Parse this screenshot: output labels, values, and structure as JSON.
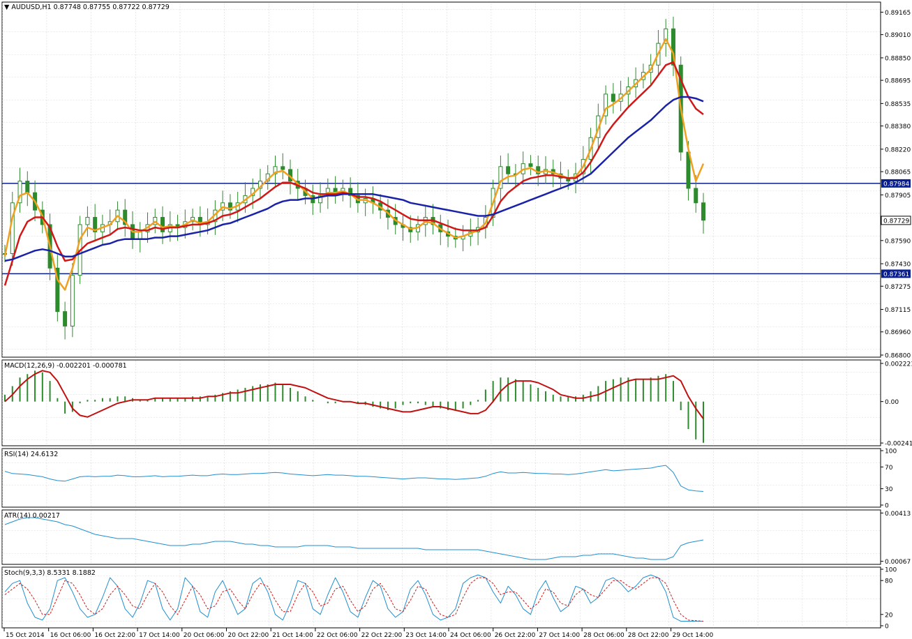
{
  "chart_data": [
    {
      "type": "line",
      "panel": "price",
      "title": "AUDUSD,H1 0.87748 0.87755 0.87722 0.87729",
      "ylim": [
        0.868,
        0.8922
      ],
      "y_ticks": [
        "0.89165",
        "0.89010",
        "0.88850",
        "0.88695",
        "0.88535",
        "0.88380",
        "0.88220",
        "0.88065",
        "0.87905",
        "0.87590",
        "0.87430",
        "0.87275",
        "0.87115",
        "0.86960",
        "0.86800"
      ],
      "x_ticks": [
        "15 Oct 2014",
        "16 Oct 06:00",
        "16 Oct 22:00",
        "17 Oct 14:00",
        "20 Oct 06:00",
        "20 Oct 22:00",
        "21 Oct 14:00",
        "22 Oct 06:00",
        "22 Oct 22:00",
        "23 Oct 14:00",
        "24 Oct 06:00",
        "26 Oct 22:00",
        "27 Oct 14:00",
        "28 Oct 06:00",
        "28 Oct 22:00",
        "29 Oct 14:00"
      ],
      "horizontal_lines": [
        {
          "value": 0.87984,
          "label": "0.87984",
          "color": "#0a1f8f"
        },
        {
          "value": 0.87361,
          "label": "0.87361",
          "color": "#0a1f8f"
        }
      ],
      "last_price": {
        "value": 0.87729,
        "label": "0.87729"
      },
      "close": [
        0.875,
        0.8785,
        0.88,
        0.8792,
        0.878,
        0.877,
        0.874,
        0.871,
        0.87,
        0.8735,
        0.877,
        0.8775,
        0.8765,
        0.877,
        0.8772,
        0.878,
        0.877,
        0.876,
        0.8765,
        0.877,
        0.8775,
        0.8765,
        0.877,
        0.8768,
        0.8772,
        0.8775,
        0.877,
        0.8772,
        0.878,
        0.8785,
        0.878,
        0.8785,
        0.879,
        0.8795,
        0.88,
        0.8805,
        0.881,
        0.8808,
        0.88,
        0.8795,
        0.879,
        0.8785,
        0.879,
        0.8795,
        0.8792,
        0.8795,
        0.879,
        0.8785,
        0.8788,
        0.8785,
        0.878,
        0.8775,
        0.877,
        0.8768,
        0.8765,
        0.877,
        0.8775,
        0.877,
        0.8765,
        0.8762,
        0.876,
        0.8762,
        0.8765,
        0.8768,
        0.8775,
        0.8795,
        0.881,
        0.8805,
        0.8805,
        0.8812,
        0.881,
        0.8805,
        0.8808,
        0.8805,
        0.8802,
        0.88,
        0.8805,
        0.8815,
        0.883,
        0.8845,
        0.886,
        0.8855,
        0.886,
        0.8865,
        0.887,
        0.8875,
        0.888,
        0.8895,
        0.8905,
        0.888,
        0.882,
        0.8795,
        0.8785,
        0.8773
      ],
      "series": [
        {
          "name": "",
          "color": "#f0a020",
          "values": [
            0.8748,
            0.8775,
            0.879,
            0.8792,
            0.8786,
            0.8776,
            0.8755,
            0.8732,
            0.8725,
            0.874,
            0.876,
            0.8768,
            0.8766,
            0.8768,
            0.877,
            0.8776,
            0.8772,
            0.8765,
            0.8765,
            0.8768,
            0.8772,
            0.8768,
            0.8769,
            0.8768,
            0.877,
            0.8773,
            0.8771,
            0.8772,
            0.8777,
            0.8782,
            0.8781,
            0.8783,
            0.8787,
            0.8791,
            0.8796,
            0.8801,
            0.8806,
            0.8807,
            0.8803,
            0.8798,
            0.8793,
            0.8788,
            0.8789,
            0.8792,
            0.8792,
            0.8793,
            0.8791,
            0.8787,
            0.8787,
            0.8785,
            0.8782,
            0.8778,
            0.8773,
            0.877,
            0.8767,
            0.8768,
            0.8772,
            0.8771,
            0.8767,
            0.8764,
            0.8761,
            0.8762,
            0.8764,
            0.8766,
            0.8771,
            0.8785,
            0.88,
            0.8803,
            0.8804,
            0.8808,
            0.8809,
            0.8806,
            0.8807,
            0.8806,
            0.8804,
            0.8802,
            0.8803,
            0.881,
            0.8822,
            0.8836,
            0.885,
            0.8853,
            0.8857,
            0.8862,
            0.8867,
            0.8872,
            0.8877,
            0.8888,
            0.8898,
            0.8888,
            0.885,
            0.8822,
            0.88,
            0.8812
          ]
        },
        {
          "name": "",
          "color": "#d01818",
          "values": [
            0.8728,
            0.8745,
            0.8762,
            0.8772,
            0.8775,
            0.8775,
            0.8768,
            0.8755,
            0.8745,
            0.8746,
            0.8752,
            0.8757,
            0.8759,
            0.8761,
            0.8763,
            0.8767,
            0.8768,
            0.8767,
            0.8766,
            0.8766,
            0.8768,
            0.8767,
            0.8768,
            0.8768,
            0.8769,
            0.877,
            0.877,
            0.8771,
            0.8773,
            0.8776,
            0.8777,
            0.8779,
            0.8782,
            0.8785,
            0.8788,
            0.8792,
            0.8796,
            0.8799,
            0.8799,
            0.8797,
            0.8795,
            0.8792,
            0.8791,
            0.8791,
            0.8791,
            0.8792,
            0.8791,
            0.8789,
            0.8789,
            0.8788,
            0.8786,
            0.8783,
            0.878,
            0.8777,
            0.8774,
            0.8773,
            0.8773,
            0.8773,
            0.8771,
            0.8769,
            0.8767,
            0.8766,
            0.8766,
            0.8766,
            0.8768,
            0.8776,
            0.8786,
            0.8792,
            0.8796,
            0.88,
            0.8802,
            0.8803,
            0.8804,
            0.8804,
            0.8803,
            0.8802,
            0.8802,
            0.8806,
            0.8813,
            0.8822,
            0.8832,
            0.8839,
            0.8845,
            0.8851,
            0.8856,
            0.8861,
            0.8866,
            0.8873,
            0.888,
            0.8882,
            0.887,
            0.8858,
            0.885,
            0.8846
          ]
        },
        {
          "name": "",
          "color": "#1a22a8",
          "values": [
            0.8745,
            0.8746,
            0.8748,
            0.875,
            0.8752,
            0.8753,
            0.8752,
            0.875,
            0.8748,
            0.8748,
            0.875,
            0.8752,
            0.8754,
            0.8756,
            0.8757,
            0.8759,
            0.876,
            0.876,
            0.876,
            0.876,
            0.8761,
            0.8761,
            0.8762,
            0.8762,
            0.8763,
            0.8764,
            0.8765,
            0.8766,
            0.8768,
            0.877,
            0.8771,
            0.8773,
            0.8775,
            0.8777,
            0.8779,
            0.8781,
            0.8784,
            0.8786,
            0.8787,
            0.8787,
            0.8788,
            0.8788,
            0.8789,
            0.879,
            0.879,
            0.8791,
            0.8791,
            0.8791,
            0.8791,
            0.8791,
            0.879,
            0.8789,
            0.8788,
            0.8787,
            0.8785,
            0.8784,
            0.8783,
            0.8782,
            0.8781,
            0.878,
            0.8779,
            0.8778,
            0.8777,
            0.8776,
            0.8776,
            0.8777,
            0.8779,
            0.8781,
            0.8783,
            0.8785,
            0.8787,
            0.8789,
            0.8791,
            0.8793,
            0.8795,
            0.8797,
            0.8799,
            0.8802,
            0.8805,
            0.881,
            0.8815,
            0.882,
            0.8825,
            0.883,
            0.8834,
            0.8838,
            0.8842,
            0.8847,
            0.8852,
            0.8856,
            0.8858,
            0.8858,
            0.8857,
            0.8855
          ]
        }
      ]
    },
    {
      "type": "bar",
      "panel": "macd",
      "title": "MACD(12,26,9) -0.002201 -0.000781",
      "ylim": [
        -0.00245,
        0.0023
      ],
      "y_ticks": [
        "0.002221",
        "0.00",
        "-0.002412"
      ],
      "histogram": [
        0.0004,
        0.0009,
        0.0014,
        0.0016,
        0.0018,
        0.0017,
        0.0012,
        0.0002,
        -0.0007,
        -0.0006,
        -0.0001,
        0.0001,
        0.0001,
        0.0002,
        0.0002,
        0.0003,
        0.0003,
        0.0002,
        0.0001,
        0.0001,
        0.0002,
        0.0002,
        0.0002,
        0.0002,
        0.0002,
        0.0003,
        0.0003,
        0.0003,
        0.0004,
        0.0005,
        0.0006,
        0.0007,
        0.0008,
        0.0009,
        0.001,
        0.001,
        0.0011,
        0.001,
        0.0008,
        0.0006,
        0.0003,
        0.0001,
        0.0,
        -0.0001,
        -0.0001,
        0.0,
        0.0,
        -0.0001,
        -0.0002,
        -0.0003,
        -0.0004,
        -0.0005,
        -0.0004,
        -0.0002,
        -0.0001,
        -0.0001,
        -0.0002,
        -0.0003,
        -0.0004,
        -0.0005,
        -0.0005,
        -0.0004,
        -0.0002,
        0.0001,
        0.0007,
        0.0012,
        0.0014,
        0.0014,
        0.0013,
        0.0012,
        0.001,
        0.0008,
        0.0006,
        0.0004,
        0.0003,
        0.0003,
        0.0003,
        0.0004,
        0.0006,
        0.0009,
        0.0012,
        0.0013,
        0.0014,
        0.0014,
        0.0013,
        0.0013,
        0.0014,
        0.0015,
        0.0016,
        0.0012,
        -0.0005,
        -0.0016,
        -0.0022,
        -0.0024
      ],
      "signal": [
        0.0,
        0.0004,
        0.0009,
        0.0013,
        0.0016,
        0.0018,
        0.0017,
        0.0012,
        0.0004,
        -0.0004,
        -0.0008,
        -0.0009,
        -0.0007,
        -0.0005,
        -0.0003,
        -0.0001,
        0.0,
        0.0001,
        0.0001,
        0.0001,
        0.0002,
        0.0002,
        0.0002,
        0.0002,
        0.0002,
        0.0002,
        0.0002,
        0.0003,
        0.0003,
        0.0004,
        0.0005,
        0.0005,
        0.0006,
        0.0007,
        0.0008,
        0.0009,
        0.001,
        0.001,
        0.001,
        0.0009,
        0.0008,
        0.0006,
        0.0004,
        0.0002,
        0.0001,
        0.0,
        0.0,
        -0.0001,
        -0.0001,
        -0.0002,
        -0.0003,
        -0.0004,
        -0.0005,
        -0.0006,
        -0.0006,
        -0.0005,
        -0.0004,
        -0.0003,
        -0.0003,
        -0.0004,
        -0.0005,
        -0.0006,
        -0.0007,
        -0.0007,
        -0.0005,
        0.0,
        0.0006,
        0.001,
        0.0012,
        0.0012,
        0.0012,
        0.0011,
        0.0009,
        0.0007,
        0.0004,
        0.0003,
        0.0002,
        0.0002,
        0.0003,
        0.0004,
        0.0006,
        0.0008,
        0.001,
        0.0012,
        0.0013,
        0.0013,
        0.0013,
        0.0013,
        0.0014,
        0.0015,
        0.0012,
        0.0003,
        -0.0004,
        -0.001
      ]
    },
    {
      "type": "line",
      "panel": "rsi",
      "title": "RSI(14) 24.6132",
      "ylim": [
        0,
        100
      ],
      "y_ticks": [
        "100",
        "70",
        "30",
        "0"
      ],
      "values": [
        62,
        58,
        57,
        56,
        54,
        52,
        48,
        45,
        44,
        48,
        52,
        53,
        52,
        53,
        53,
        55,
        54,
        52,
        52,
        53,
        54,
        52,
        53,
        53,
        54,
        55,
        54,
        54,
        56,
        57,
        56,
        56,
        57,
        58,
        58,
        59,
        60,
        59,
        57,
        56,
        55,
        54,
        55,
        56,
        55,
        55,
        54,
        53,
        53,
        52,
        51,
        50,
        49,
        48,
        49,
        50,
        50,
        49,
        48,
        48,
        47,
        48,
        49,
        50,
        53,
        58,
        61,
        59,
        59,
        60,
        59,
        58,
        58,
        57,
        57,
        56,
        57,
        59,
        61,
        63,
        65,
        63,
        64,
        65,
        66,
        67,
        68,
        71,
        73,
        60,
        35,
        28,
        26,
        25
      ]
    },
    {
      "type": "line",
      "panel": "atr",
      "title": "ATR(14) 0.00217",
      "ylim": [
        0.0006,
        0.0042
      ],
      "y_ticks": [
        "0.00413",
        "0.00067"
      ],
      "values": [
        0.0033,
        0.0035,
        0.0037,
        0.0038,
        0.0038,
        0.0037,
        0.0036,
        0.0035,
        0.0033,
        0.0032,
        0.003,
        0.0028,
        0.0026,
        0.0025,
        0.0024,
        0.0023,
        0.0023,
        0.0023,
        0.0022,
        0.0021,
        0.002,
        0.0019,
        0.0018,
        0.0018,
        0.0018,
        0.0019,
        0.0019,
        0.002,
        0.0021,
        0.0021,
        0.0021,
        0.002,
        0.0019,
        0.0019,
        0.0018,
        0.0018,
        0.0017,
        0.0017,
        0.0017,
        0.0017,
        0.0018,
        0.0018,
        0.0018,
        0.0018,
        0.0017,
        0.0017,
        0.0017,
        0.0016,
        0.0016,
        0.0016,
        0.0016,
        0.0016,
        0.0016,
        0.0016,
        0.0016,
        0.0016,
        0.0015,
        0.0015,
        0.0015,
        0.0015,
        0.0015,
        0.0015,
        0.0015,
        0.0015,
        0.0014,
        0.0013,
        0.0012,
        0.0011,
        0.001,
        0.0009,
        0.0008,
        0.0008,
        0.0008,
        0.0009,
        0.001,
        0.001,
        0.001,
        0.0011,
        0.0011,
        0.0012,
        0.0012,
        0.0012,
        0.0011,
        0.001,
        0.0009,
        0.0009,
        0.0008,
        0.0008,
        0.0008,
        0.001,
        0.0018,
        0.002,
        0.0021,
        0.0022
      ]
    },
    {
      "type": "line",
      "panel": "stochastic",
      "title": "Stoch(9,3,3) 8.5331 8.1882",
      "ylim": [
        0,
        100
      ],
      "y_ticks": [
        "100",
        "80",
        "20",
        "0"
      ],
      "series": [
        {
          "name": "",
          "color": "#1f8fd0",
          "values": [
            60,
            75,
            80,
            40,
            15,
            10,
            30,
            80,
            85,
            60,
            30,
            15,
            20,
            50,
            85,
            70,
            30,
            15,
            40,
            80,
            75,
            30,
            10,
            30,
            85,
            70,
            25,
            15,
            60,
            80,
            50,
            20,
            30,
            75,
            85,
            60,
            20,
            10,
            40,
            80,
            75,
            30,
            20,
            55,
            85,
            60,
            25,
            15,
            50,
            80,
            70,
            30,
            15,
            25,
            65,
            80,
            55,
            20,
            10,
            15,
            30,
            75,
            85,
            90,
            85,
            60,
            40,
            70,
            55,
            30,
            20,
            60,
            80,
            50,
            25,
            35,
            70,
            65,
            40,
            50,
            80,
            85,
            75,
            60,
            70,
            85,
            90,
            85,
            60,
            15,
            8,
            8,
            8,
            8
          ]
        },
        {
          "name": "",
          "color": "#d01818",
          "values": [
            55,
            65,
            75,
            65,
            45,
            20,
            20,
            50,
            80,
            75,
            55,
            30,
            20,
            30,
            55,
            70,
            55,
            35,
            30,
            55,
            75,
            60,
            35,
            20,
            45,
            70,
            55,
            30,
            35,
            60,
            65,
            45,
            30,
            55,
            75,
            70,
            45,
            25,
            25,
            55,
            75,
            60,
            35,
            40,
            65,
            70,
            45,
            25,
            35,
            65,
            75,
            55,
            30,
            25,
            45,
            70,
            65,
            40,
            20,
            15,
            20,
            50,
            75,
            85,
            85,
            75,
            55,
            60,
            60,
            45,
            30,
            40,
            65,
            60,
            40,
            35,
            55,
            65,
            55,
            50,
            65,
            80,
            80,
            70,
            65,
            75,
            85,
            85,
            75,
            45,
            20,
            10,
            9,
            8
          ]
        }
      ]
    }
  ]
}
